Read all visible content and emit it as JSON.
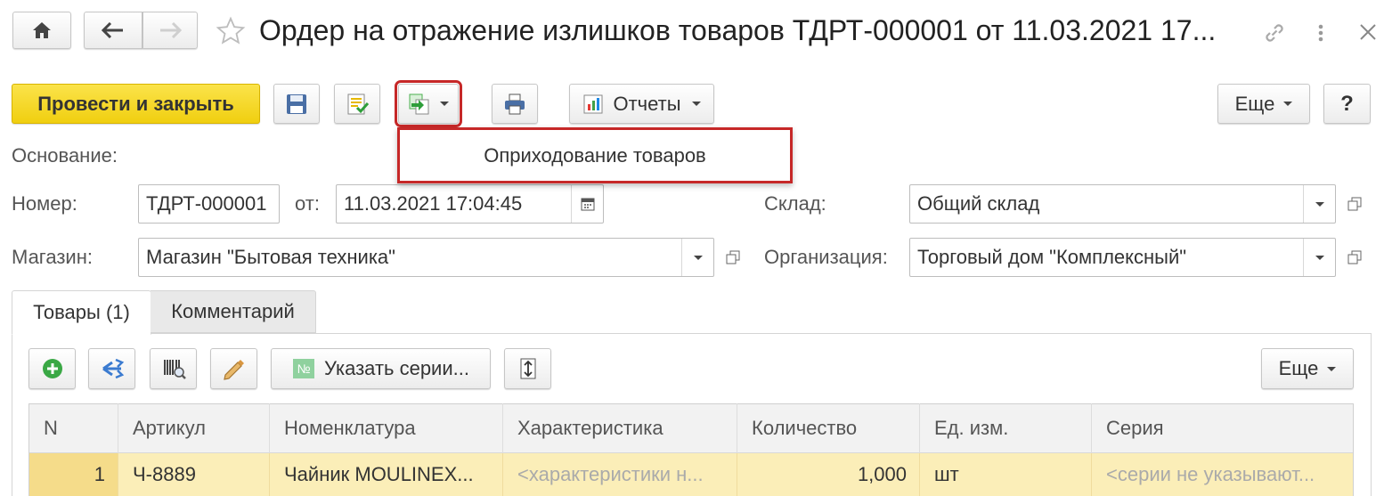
{
  "window": {
    "title": "Ордер на отражение излишков товаров ТДРТ-000001 от 11.03.2021 17..."
  },
  "toolbar": {
    "post_close_label": "Провести и закрыть",
    "reports_label": "Отчеты",
    "more_label": "Еще",
    "help_label": "?"
  },
  "dropdown_menu": {
    "items": [
      "Оприходование товаров"
    ]
  },
  "form": {
    "basis_label": "Основание:",
    "number_label": "Номер:",
    "number_value": "ТДРТ-000001",
    "date_label": "от:",
    "date_value": "11.03.2021 17:04:45",
    "warehouse_label": "Склад:",
    "warehouse_value": "Общий склад",
    "store_label": "Магазин:",
    "store_value": "Магазин \"Бытовая техника\"",
    "organization_label": "Организация:",
    "organization_value": "Торговый дом \"Комплексный\""
  },
  "tabs": [
    {
      "label": "Товары (1)",
      "active": true
    },
    {
      "label": "Комментарий",
      "active": false
    }
  ],
  "table_toolbar": {
    "series_label": "Указать серии...",
    "more_label": "Еще"
  },
  "table": {
    "columns": [
      "N",
      "Артикул",
      "Номенклатура",
      "Характеристика",
      "Количество",
      "Ед. изм.",
      "Серия"
    ],
    "rows": [
      [
        "1",
        "Ч-8889",
        "Чайник MOULINEX...",
        "<характеристики н...",
        "1,000",
        "шт",
        "<серии не указывают..."
      ]
    ]
  },
  "colors": {
    "primary_button": "#f5d51a",
    "highlight_border": "#c62828",
    "selected_row": "#fbeeb8"
  }
}
